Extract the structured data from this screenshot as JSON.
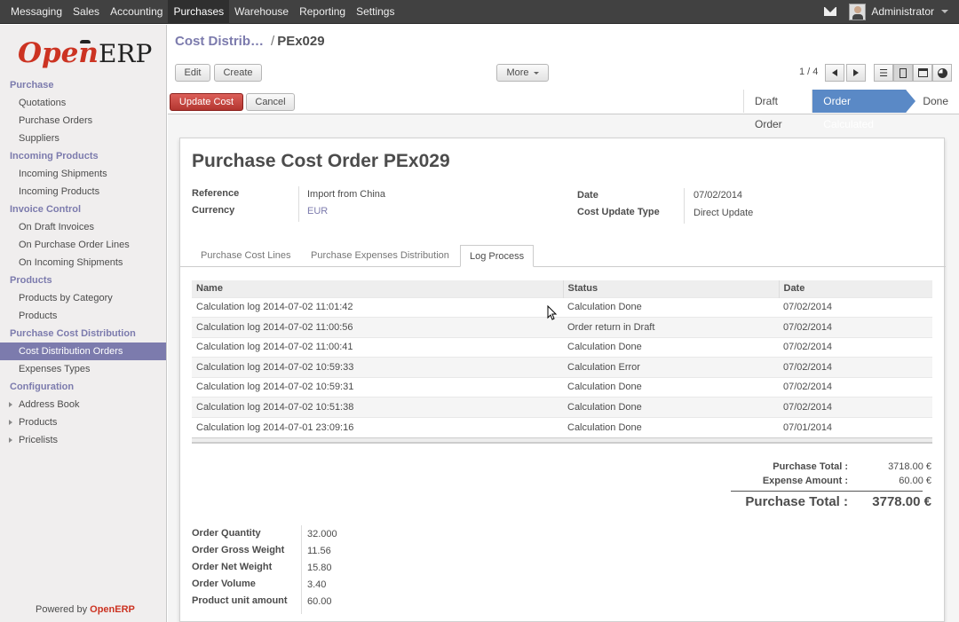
{
  "topbar": {
    "menu": [
      "Messaging",
      "Sales",
      "Accounting",
      "Purchases",
      "Warehouse",
      "Reporting",
      "Settings"
    ],
    "active": "Purchases",
    "user": "Administrator"
  },
  "sidebar": {
    "logo_open": "Open",
    "logo_erp": "ERP",
    "sections": [
      {
        "title": "Purchase",
        "items": [
          "Quotations",
          "Purchase Orders",
          "Suppliers"
        ]
      },
      {
        "title": "Incoming Products",
        "items": [
          "Incoming Shipments",
          "Incoming Products"
        ]
      },
      {
        "title": "Invoice Control",
        "items": [
          "On Draft Invoices",
          "On Purchase Order Lines",
          "On Incoming Shipments"
        ]
      },
      {
        "title": "Products",
        "items": [
          "Products by Category",
          "Products"
        ]
      },
      {
        "title": "Purchase Cost Distribution",
        "items": [
          "Cost Distribution Orders",
          "Expenses Types"
        ]
      },
      {
        "title": "Configuration",
        "items": [
          "Address Book",
          "Products",
          "Pricelists"
        ]
      }
    ],
    "active_item": "Cost Distribution Orders",
    "powered_prefix": "Powered by ",
    "powered_brand": "OpenERP"
  },
  "header": {
    "breadcrumb_link": "Cost Distrib…",
    "breadcrumb_sep": "/",
    "breadcrumb_current": "PEx029",
    "edit_label": "Edit",
    "create_label": "Create",
    "more_label": "More",
    "pager": "1 / 4",
    "update_cost_label": "Update Cost",
    "cancel_label": "Cancel",
    "stages": [
      "Draft Order",
      "Order Calculated",
      "Done"
    ],
    "active_stage": "Order Calculated"
  },
  "form": {
    "title_prefix": "Purchase Cost Order",
    "title_ref": "PEx029",
    "reference_label": "Reference",
    "reference_value": "Import from China",
    "currency_label": "Currency",
    "currency_value": "EUR",
    "date_label": "Date",
    "date_value": "07/02/2014",
    "cost_update_type_label": "Cost Update Type",
    "cost_update_type_value": "Direct Update",
    "tabs": [
      "Purchase Cost Lines",
      "Purchase Expenses Distribution",
      "Log Process"
    ],
    "active_tab": "Log Process",
    "log_columns": [
      "Name",
      "Status",
      "Date"
    ],
    "log_rows": [
      [
        "Calculation log 2014-07-02 11:01:42",
        "Calculation Done",
        "07/02/2014"
      ],
      [
        "Calculation log 2014-07-02 11:00:56",
        "Order return in Draft",
        "07/02/2014"
      ],
      [
        "Calculation log 2014-07-02 11:00:41",
        "Calculation Done",
        "07/02/2014"
      ],
      [
        "Calculation log 2014-07-02 10:59:33",
        "Calculation Error",
        "07/02/2014"
      ],
      [
        "Calculation log 2014-07-02 10:59:31",
        "Calculation Done",
        "07/02/2014"
      ],
      [
        "Calculation log 2014-07-02 10:51:38",
        "Calculation Done",
        "07/02/2014"
      ],
      [
        "Calculation log 2014-07-01 23:09:16",
        "Calculation Done",
        "07/01/2014"
      ]
    ],
    "purchase_total_label": "Purchase Total :",
    "purchase_total_value": "3718.00 €",
    "expense_amount_label": "Expense Amount :",
    "expense_amount_value": "60.00 €",
    "grand_total_label": "Purchase Total :",
    "grand_total_value": "3778.00 €",
    "summary": [
      {
        "label": "Order Quantity",
        "value": "32.000"
      },
      {
        "label": "Order Gross Weight",
        "value": "11.56"
      },
      {
        "label": "Order Net Weight",
        "value": "15.80"
      },
      {
        "label": "Order Volume",
        "value": "3.40"
      },
      {
        "label": "Product unit amount",
        "value": "60.00"
      }
    ]
  },
  "colors": {
    "accent": "#7c7bad",
    "topbar": "#414141",
    "primary_button": "#c2332d",
    "active_stage": "#5a89c6"
  }
}
